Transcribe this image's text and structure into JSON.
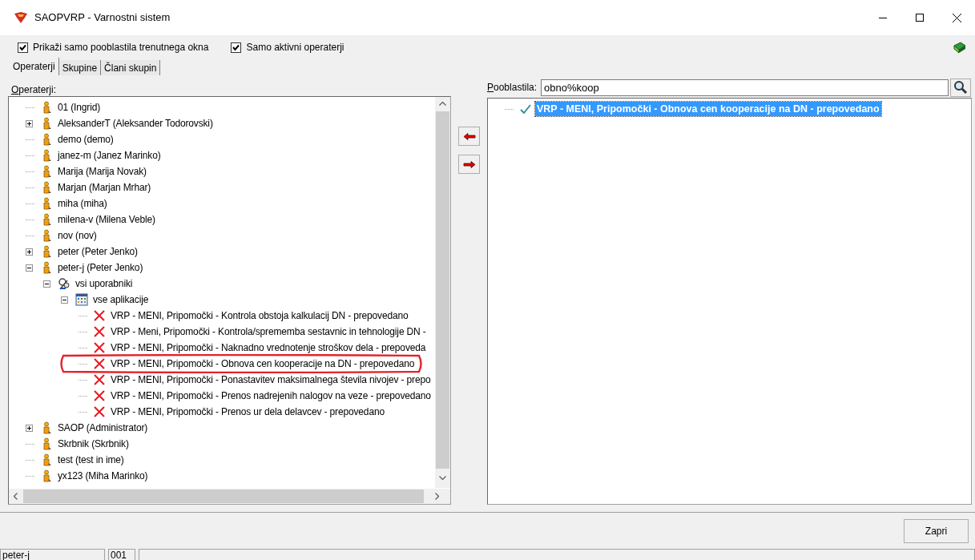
{
  "window": {
    "title": "SAOPVRP - Varnostni sistem"
  },
  "options": [
    {
      "label": "Prikaži samo pooblastila trenutnega okna",
      "checked": true
    },
    {
      "label": "Samo aktivni operaterji",
      "checked": true
    }
  ],
  "tabs": [
    {
      "label": "Operaterji",
      "selected": true
    },
    {
      "label": "Skupine",
      "selected": false
    },
    {
      "label": "Člani skupin",
      "selected": false
    }
  ],
  "operators_label": "Operaterji:",
  "operators": [
    {
      "label": "01 (Ingrid)",
      "kind": "user",
      "selected": false
    },
    {
      "label": "AleksanderT (Aleksander Todorovski)",
      "kind": "user",
      "selected": false,
      "expanded": false
    },
    {
      "label": "demo (demo)",
      "kind": "user",
      "selected": false
    },
    {
      "label": "janez-m (Janez Marinko)",
      "kind": "user",
      "selected": false
    },
    {
      "label": "Marija (Marija Novak)",
      "kind": "user",
      "selected": false
    },
    {
      "label": "Marjan (Marjan Mrhar)",
      "kind": "user",
      "selected": false
    },
    {
      "label": "miha (miha)",
      "kind": "user",
      "selected": false
    },
    {
      "label": "milena-v (Milena Veble)",
      "kind": "user",
      "selected": false
    },
    {
      "label": "nov (nov)",
      "kind": "user",
      "selected": false
    },
    {
      "label": "peter (Peter Jenko)",
      "kind": "user",
      "selected": false,
      "expanded": false
    },
    {
      "label": "peter-j (Peter Jenko)",
      "kind": "user",
      "selected": false,
      "expanded": true,
      "children": [
        {
          "label": "vsi uporabniki",
          "kind": "group",
          "selected": false,
          "expanded": true,
          "children": [
            {
              "label": "vse aplikacije",
              "kind": "apps",
              "selected": false,
              "expanded": true,
              "children": [
                {
                  "label": "VRP - MENI, Pripomočki - Kontrola obstoja kalkulacij DN - prepovedano",
                  "kind": "denied",
                  "selected": false,
                  "circled": false
                },
                {
                  "label": "VRP - Meni, Pripomočki - Kontrola/sprememba sestavnic in tehnologije DN -",
                  "kind": "denied",
                  "selected": false,
                  "circled": false
                },
                {
                  "label": "VRP - MENI, Pripomočki - Naknadno vrednotenje stroškov dela - prepoveda",
                  "kind": "denied",
                  "selected": false,
                  "circled": false
                },
                {
                  "label": "VRP - MENI, Pripomočki - Obnova cen kooperacije na DN - prepovedano",
                  "kind": "denied",
                  "selected": false,
                  "circled": true
                },
                {
                  "label": "VRP - MENI, Pripomočki - Ponastavitev maksimalnega števila nivojev - prepo",
                  "kind": "denied",
                  "selected": false,
                  "circled": false
                },
                {
                  "label": "VRP - MENI, Pripomočki - Prenos nadrejenih nalogov na veze - prepovedano",
                  "kind": "denied",
                  "selected": false,
                  "circled": false
                },
                {
                  "label": "VRP - MENI, Pripomočki - Prenos ur dela delavcev - prepovedano",
                  "kind": "denied",
                  "selected": false,
                  "circled": false
                }
              ]
            }
          ]
        }
      ]
    },
    {
      "label": "SAOP (Administrator)",
      "kind": "user",
      "selected": false,
      "expanded": false
    },
    {
      "label": "Skrbnik (Skrbnik)",
      "kind": "user",
      "selected": false
    },
    {
      "label": "test (test in ime)",
      "kind": "user",
      "selected": false
    },
    {
      "label": "yx123 (Miha Marinko)",
      "kind": "user",
      "selected": false
    }
  ],
  "permissions_label": "Pooblastila:",
  "permissions_search": {
    "value": "obno%koop"
  },
  "permissions": [
    {
      "label": "VRP - MENI, Pripomočki - Obnova cen kooperacije na DN - prepovedano",
      "kind": "granted",
      "selected": true
    }
  ],
  "close_button": "Zapri",
  "status_bar": [
    "peter-j",
    "001"
  ]
}
